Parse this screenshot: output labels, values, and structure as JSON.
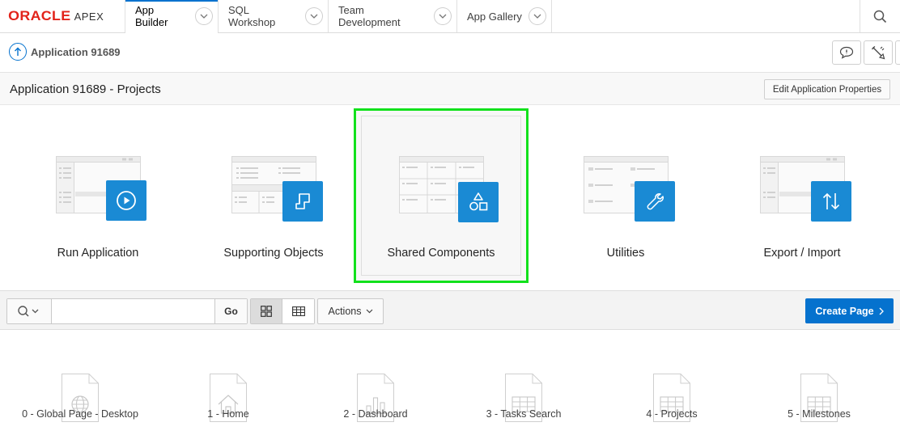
{
  "brand": {
    "oracle": "ORACLE",
    "apex": "APEX",
    "oracle_color": "#e2231a"
  },
  "nav": {
    "tabs": [
      {
        "label": "App Builder",
        "active": true
      },
      {
        "label": "SQL Workshop",
        "active": false
      },
      {
        "label": "Team Development",
        "active": false
      },
      {
        "label": "App Gallery",
        "active": false
      }
    ],
    "search_icon": "search-icon",
    "accent": "#0572ce"
  },
  "breadcrumb": {
    "title": "Application 91689"
  },
  "region": {
    "title": "Application 91689 - Projects",
    "edit_button": "Edit Application Properties"
  },
  "tiles": [
    {
      "label": "Run Application",
      "icon": "play-icon"
    },
    {
      "label": "Supporting Objects",
      "icon": "scroll-icon"
    },
    {
      "label": "Shared Components",
      "icon": "shapes-icon",
      "selected": true
    },
    {
      "label": "Utilities",
      "icon": "wrench-icon"
    },
    {
      "label": "Export / Import",
      "icon": "up-down-arrows-icon"
    }
  ],
  "toolbar": {
    "search_value": "",
    "go_label": "Go",
    "actions_label": "Actions",
    "create_label": "Create Page",
    "create_color": "#0572ce"
  },
  "pages": [
    {
      "label": "0 - Global Page - Desktop",
      "icon": "globe-icon"
    },
    {
      "label": "1 - Home",
      "icon": "home-icon"
    },
    {
      "label": "2 - Dashboard",
      "icon": "bar-chart-icon"
    },
    {
      "label": "3 - Tasks Search",
      "icon": "table-icon"
    },
    {
      "label": "4 - Projects",
      "icon": "table-icon"
    },
    {
      "label": "5 - Milestones",
      "icon": "table-icon"
    }
  ]
}
